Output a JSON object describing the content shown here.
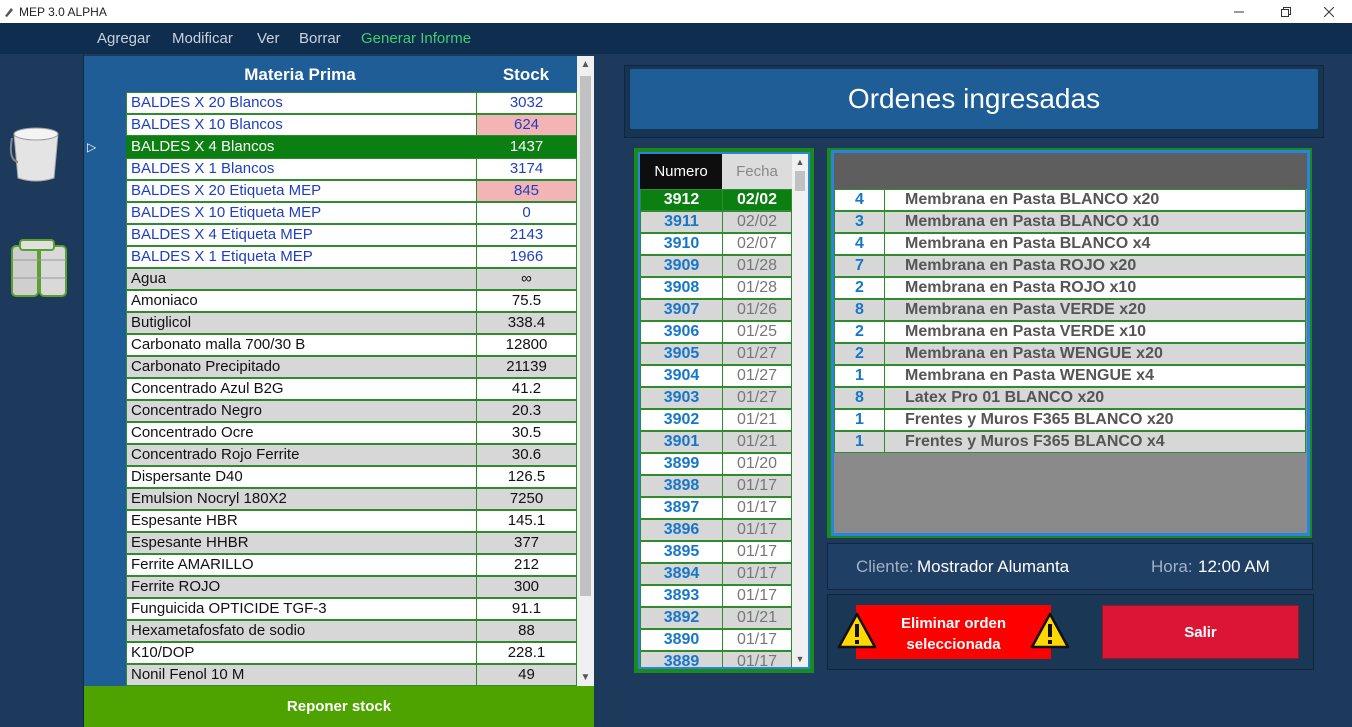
{
  "window": {
    "title": "MEP 3.0 ALPHA"
  },
  "menu": [
    {
      "label": "Agregar"
    },
    {
      "label": "Modificar"
    },
    {
      "label": "Ver"
    },
    {
      "label": "Borrar"
    },
    {
      "label": "Generar Informe"
    }
  ],
  "sidebar": {
    "icons": [
      "bucket-icon",
      "barrels-icon"
    ]
  },
  "materia": {
    "header_name": "Materia Prima",
    "header_stock": "Stock",
    "selected_marker": "▷",
    "rows": [
      {
        "name": "BALDES X 20 Blancos",
        "stock": "3032",
        "style": "blue"
      },
      {
        "name": "BALDES X 10 Blancos",
        "stock": "624",
        "style": "blue",
        "alert": true
      },
      {
        "name": "BALDES X 4 Blancos",
        "stock": "1437",
        "style": "selected"
      },
      {
        "name": "BALDES X 1 Blancos",
        "stock": "3174",
        "style": "blue"
      },
      {
        "name": "BALDES X 20 Etiqueta MEP",
        "stock": "845",
        "style": "blue",
        "alert": true
      },
      {
        "name": "BALDES X 10 Etiqueta MEP",
        "stock": "0",
        "style": "blue"
      },
      {
        "name": "BALDES X 4 Etiqueta MEP",
        "stock": "2143",
        "style": "blue"
      },
      {
        "name": "BALDES X 1 Etiqueta MEP",
        "stock": "1966",
        "style": "blue"
      },
      {
        "name": "Agua",
        "stock": "∞",
        "style": "gray"
      },
      {
        "name": "Amoniaco",
        "stock": "75.5",
        "style": "white"
      },
      {
        "name": "Butiglicol",
        "stock": "338.4",
        "style": "gray"
      },
      {
        "name": "Carbonato malla 700/30 B",
        "stock": "12800",
        "style": "white"
      },
      {
        "name": "Carbonato Precipitado",
        "stock": "21139",
        "style": "gray"
      },
      {
        "name": "Concentrado Azul B2G",
        "stock": "41.2",
        "style": "white"
      },
      {
        "name": "Concentrado Negro",
        "stock": "20.3",
        "style": "gray"
      },
      {
        "name": "Concentrado Ocre",
        "stock": "30.5",
        "style": "white"
      },
      {
        "name": "Concentrado Rojo Ferrite",
        "stock": "30.6",
        "style": "gray"
      },
      {
        "name": "Dispersante D40",
        "stock": "126.5",
        "style": "white"
      },
      {
        "name": "Emulsion Nocryl 180X2",
        "stock": "7250",
        "style": "gray"
      },
      {
        "name": "Espesante HBR",
        "stock": "145.1",
        "style": "white"
      },
      {
        "name": "Espesante HHBR",
        "stock": "377",
        "style": "gray"
      },
      {
        "name": "Ferrite AMARILLO",
        "stock": "212",
        "style": "white"
      },
      {
        "name": "Ferrite ROJO",
        "stock": "300",
        "style": "gray"
      },
      {
        "name": "Funguicida OPTICIDE TGF-3",
        "stock": "91.1",
        "style": "white"
      },
      {
        "name": "Hexametafosfato de sodio",
        "stock": "88",
        "style": "gray"
      },
      {
        "name": "K10/DOP",
        "stock": "228.1",
        "style": "white"
      },
      {
        "name": "Nonil Fenol 10 M",
        "stock": "49",
        "style": "gray"
      }
    ],
    "reponer_label": "Reponer stock"
  },
  "ordenes": {
    "title": "Ordenes ingresadas",
    "col_numero": "Numero",
    "col_fecha": "Fecha",
    "rows": [
      {
        "numero": "3912",
        "fecha": "02/02",
        "selected": true
      },
      {
        "numero": "3911",
        "fecha": "02/02"
      },
      {
        "numero": "3910",
        "fecha": "02/07"
      },
      {
        "numero": "3909",
        "fecha": "01/28"
      },
      {
        "numero": "3908",
        "fecha": "01/28"
      },
      {
        "numero": "3907",
        "fecha": "01/26"
      },
      {
        "numero": "3906",
        "fecha": "01/25"
      },
      {
        "numero": "3905",
        "fecha": "01/27"
      },
      {
        "numero": "3904",
        "fecha": "01/27"
      },
      {
        "numero": "3903",
        "fecha": "01/27"
      },
      {
        "numero": "3902",
        "fecha": "01/21"
      },
      {
        "numero": "3901",
        "fecha": "01/21"
      },
      {
        "numero": "3899",
        "fecha": "01/20"
      },
      {
        "numero": "3898",
        "fecha": "01/17"
      },
      {
        "numero": "3897",
        "fecha": "01/17"
      },
      {
        "numero": "3896",
        "fecha": "01/17"
      },
      {
        "numero": "3895",
        "fecha": "01/17"
      },
      {
        "numero": "3894",
        "fecha": "01/17"
      },
      {
        "numero": "3893",
        "fecha": "01/17"
      },
      {
        "numero": "3892",
        "fecha": "01/21"
      },
      {
        "numero": "3890",
        "fecha": "01/17"
      },
      {
        "numero": "3889",
        "fecha": "01/17"
      }
    ]
  },
  "detalle": {
    "rows": [
      {
        "qty": "4",
        "product": "Membrana en Pasta BLANCO x20"
      },
      {
        "qty": "3",
        "product": "Membrana en Pasta BLANCO x10"
      },
      {
        "qty": "4",
        "product": "Membrana en Pasta BLANCO x4"
      },
      {
        "qty": "7",
        "product": "Membrana en Pasta ROJO x20"
      },
      {
        "qty": "2",
        "product": "Membrana en Pasta ROJO x10"
      },
      {
        "qty": "8",
        "product": "Membrana en Pasta VERDE x20"
      },
      {
        "qty": "2",
        "product": "Membrana en Pasta VERDE x10"
      },
      {
        "qty": "2",
        "product": "Membrana en Pasta WENGUE x20"
      },
      {
        "qty": "1",
        "product": "Membrana en Pasta WENGUE x4"
      },
      {
        "qty": "8",
        "product": "Latex Pro 01 BLANCO x20"
      },
      {
        "qty": "1",
        "product": "Frentes y Muros F365 BLANCO x20"
      },
      {
        "qty": "1",
        "product": "Frentes y Muros F365 BLANCO x4"
      }
    ]
  },
  "info": {
    "cliente_label": "Cliente:",
    "cliente_value": "Mostrador Alumanta",
    "hora_label": "Hora:",
    "hora_value": "12:00 AM"
  },
  "actions": {
    "eliminar_line1": "Eliminar orden",
    "eliminar_line2": "seleccionada",
    "salir": "Salir"
  },
  "colors": {
    "selected_green": "#0b7f12",
    "header_blue": "#1f5d97",
    "alert_pink": "#f2b4b4",
    "menu_active": "#3fcf6e",
    "eliminar_red": "#ff0000",
    "salir_red": "#dc1436"
  }
}
